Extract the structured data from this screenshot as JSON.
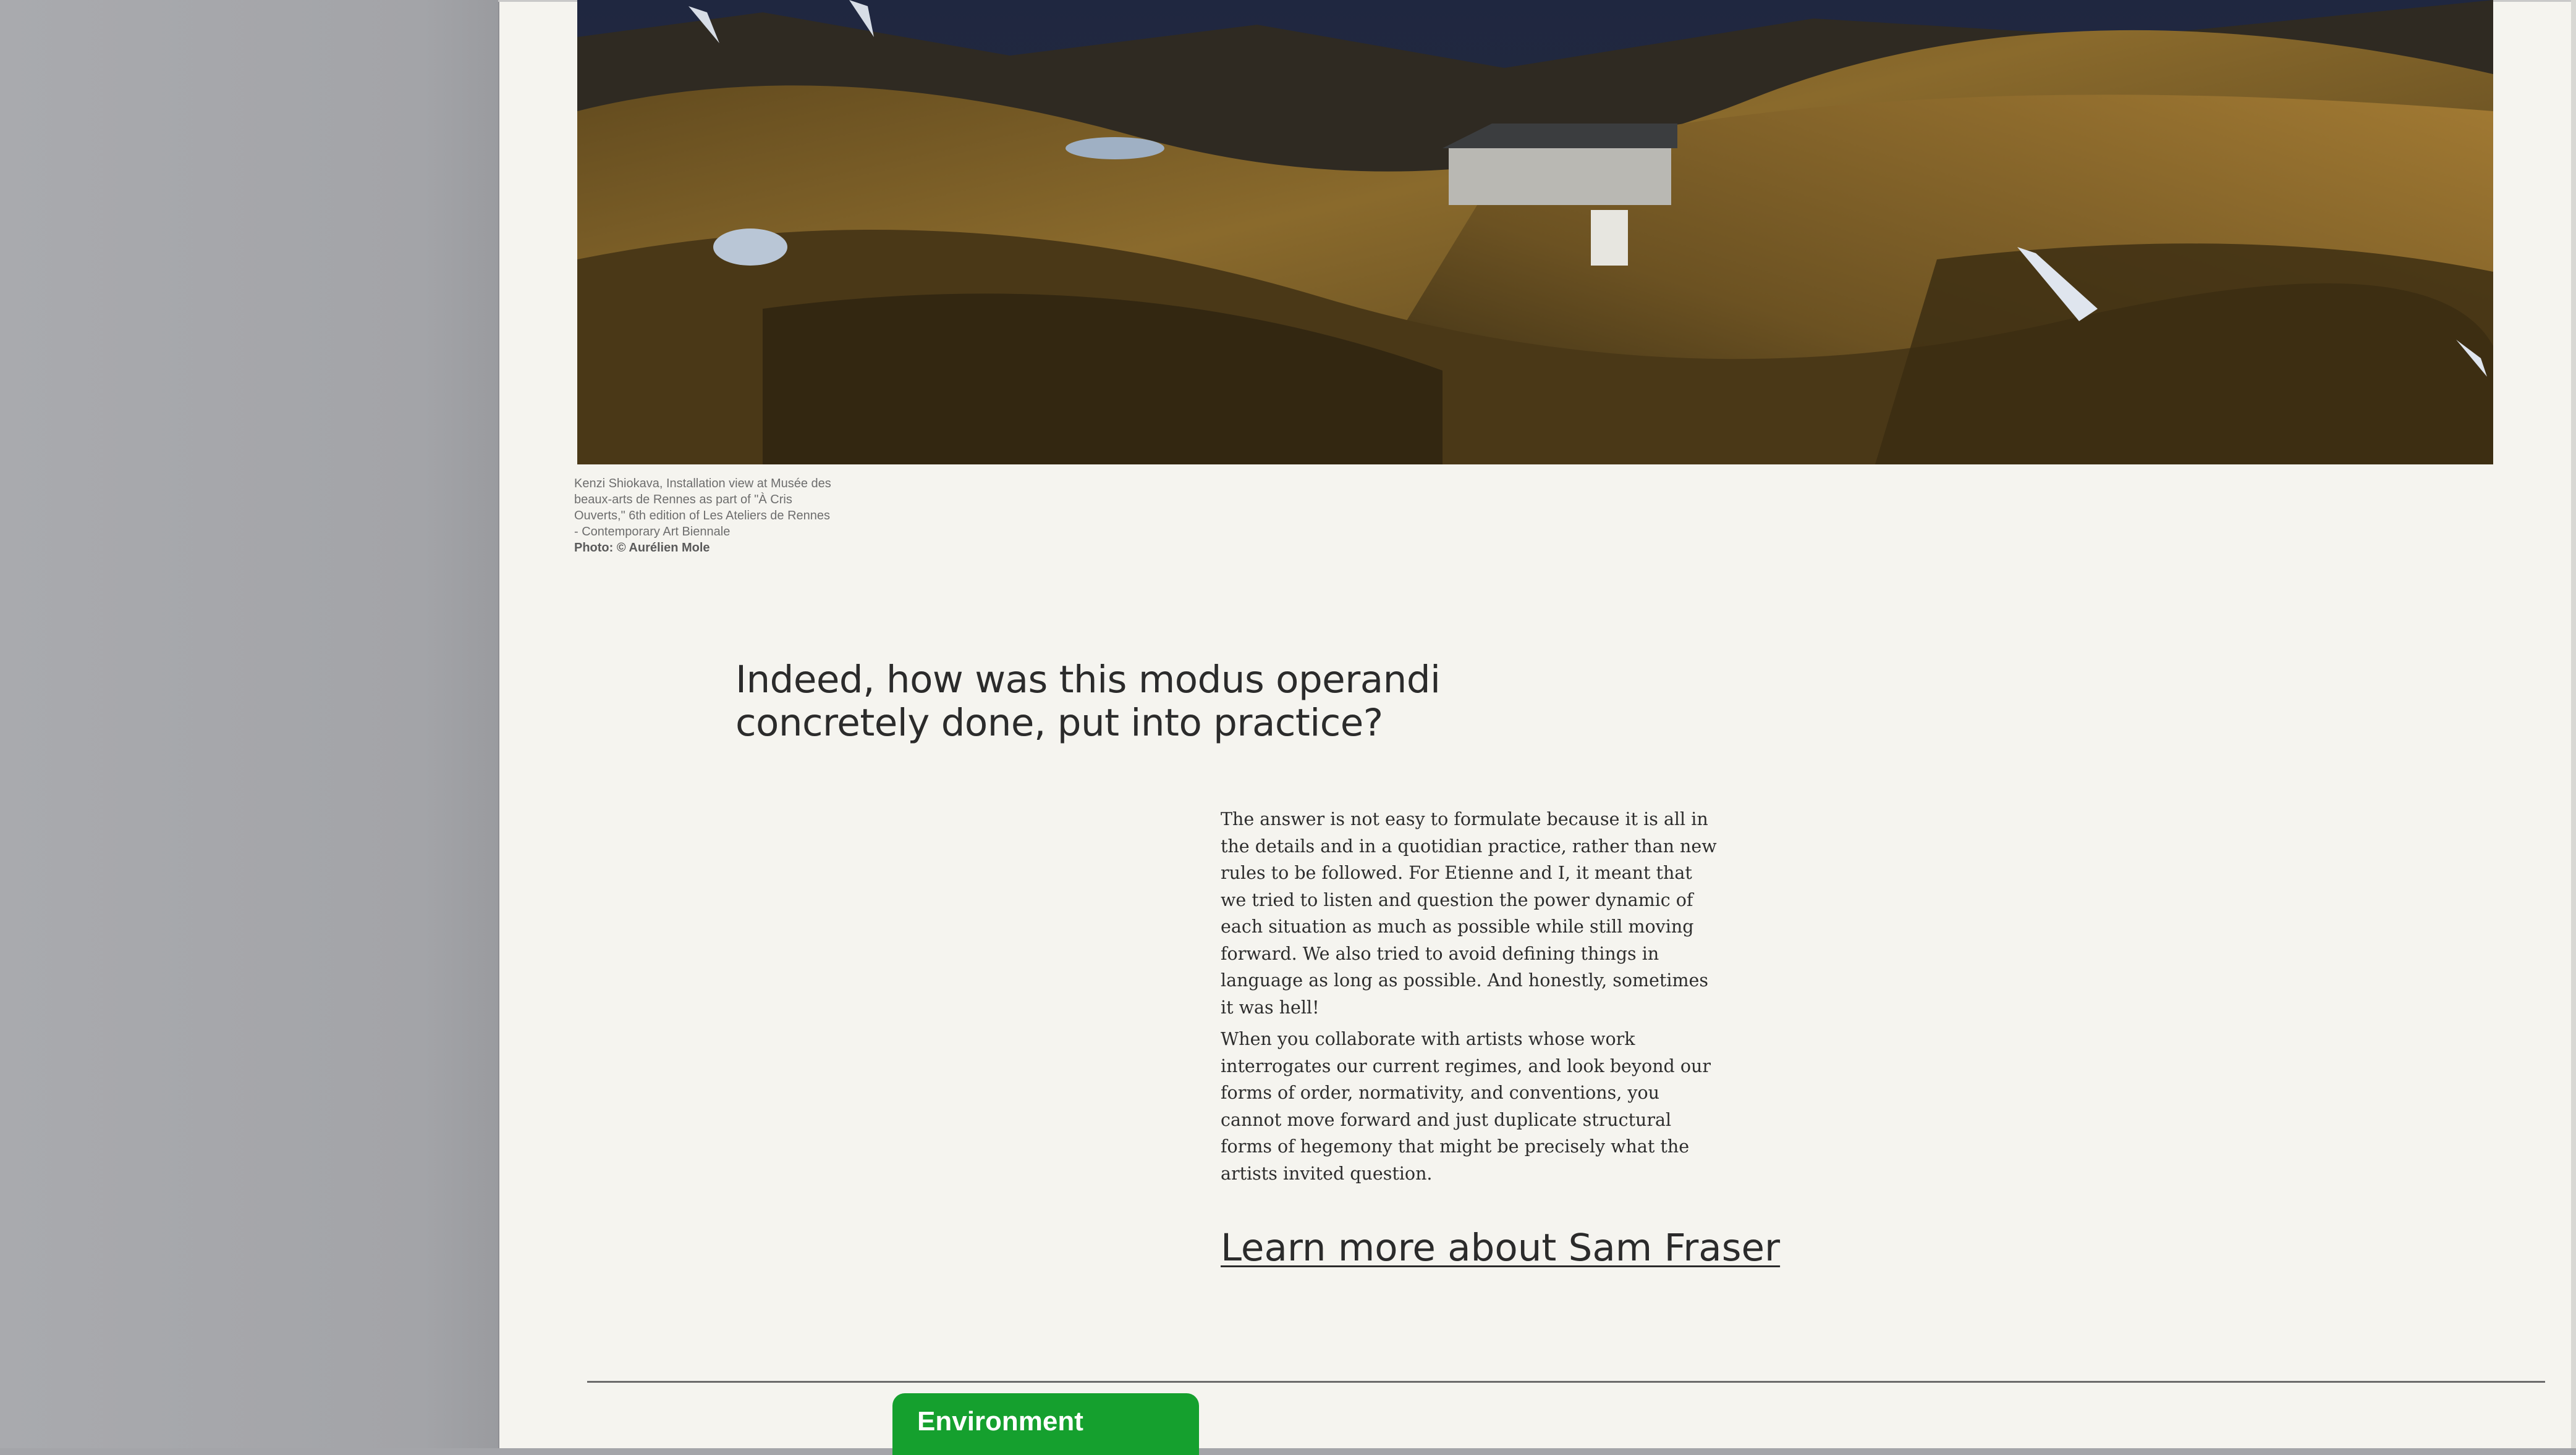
{
  "caption": {
    "lines": [
      "Kenzi Shiokava, Installation view at Musée des",
      "beaux-arts de Rennes as part of \"À Cris",
      "Ouverts,\" 6th edition of Les Ateliers de Rennes",
      "- Contemporary Art Biennale"
    ],
    "credit": "Photo: © Aurélien Mole"
  },
  "headline": {
    "line1": "Indeed, how was this modus operandi",
    "line2": "concretely done, put into practice?"
  },
  "body": {
    "paragraph1": "The answer is not easy to formulate because it is all in the details and in a quotidian practice, rather than new rules to be followed. For Etienne and I, it meant that we tried to listen and question the power dynamic of each situation as much as possible while still moving forward. We also tried to avoid defining things in language as long as possible. And honestly, sometimes it was hell!",
    "paragraph2": "When you collaborate with artists whose work interrogates our current regimes, and look beyond our forms of order, normativity, and conventions, you cannot move forward and just duplicate structural forms of hegemony that might be precisely what the artists invited question."
  },
  "learn_more": {
    "label": "Learn more about Sam Fraser"
  },
  "tag": {
    "label": "Environment",
    "color": "#15a02e"
  },
  "colors": {
    "page_bg": "#f5f4ef",
    "sidebar": "#a4a5a9",
    "text": "#2b2b2b"
  }
}
